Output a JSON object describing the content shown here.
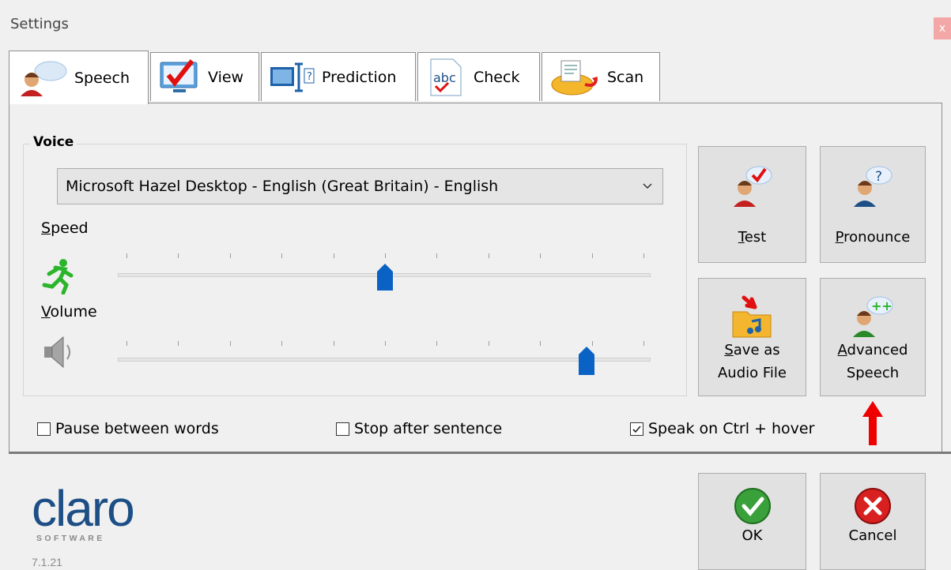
{
  "window": {
    "title": "Settings",
    "close_glyph": "x"
  },
  "tabs": [
    {
      "label": "Speech",
      "icon": "speaker-person-icon",
      "active": true
    },
    {
      "label": "View",
      "icon": "monitor-check-icon",
      "active": false
    },
    {
      "label": "Prediction",
      "icon": "text-cursor-icon",
      "active": false
    },
    {
      "label": "Check",
      "icon": "abc-check-icon",
      "active": false
    },
    {
      "label": "Scan",
      "icon": "scan-icon",
      "active": false
    }
  ],
  "voice": {
    "group_label": "Voice",
    "selected_voice": "Microsoft Hazel Desktop - English (Great Britain) - English",
    "speed": {
      "label_first": "S",
      "label_rest": "peed",
      "value_fraction": 0.5,
      "tick_count": 11
    },
    "volume": {
      "label_first": "V",
      "label_rest": "olume",
      "value_fraction": 0.89,
      "tick_count": 11
    }
  },
  "buttons": {
    "test": {
      "label_first": "T",
      "label_rest": "est"
    },
    "pronounce": {
      "label_first": "P",
      "label_rest": "ronounce"
    },
    "save_audio": {
      "line1_first": "S",
      "line1_rest": "ave as",
      "line2": "Audio File"
    },
    "advanced": {
      "line1_first": "A",
      "line1_rest": "dvanced",
      "line2": "Speech"
    },
    "ok": {
      "label": "OK"
    },
    "cancel": {
      "label": "Cancel"
    }
  },
  "options": [
    {
      "label": "Pause between words",
      "checked": false
    },
    {
      "label": "Stop after sentence",
      "checked": false
    },
    {
      "label": "Speak on Ctrl + hover",
      "checked": true
    }
  ],
  "footer": {
    "logo": "claro",
    "logo_sub": "SOFTWARE",
    "version": "7.1.21"
  },
  "colors": {
    "thumb": "#0a62c4",
    "arrow": "#ee0000",
    "logo": "#1d4f86",
    "ok_green": "#3aa03a",
    "cancel_red": "#d92020"
  }
}
